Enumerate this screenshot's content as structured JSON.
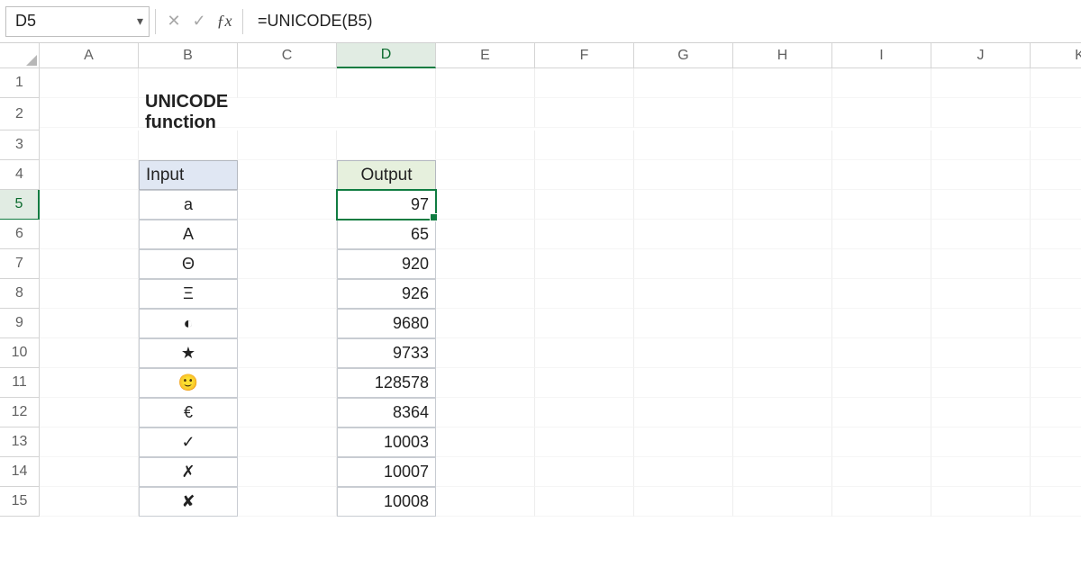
{
  "nameBox": {
    "value": "D5"
  },
  "formulaBar": {
    "value": "=UNICODE(B5)"
  },
  "columns": [
    "A",
    "B",
    "C",
    "D",
    "E",
    "F",
    "G",
    "H",
    "I",
    "J",
    "K"
  ],
  "rowNums": [
    "1",
    "2",
    "3",
    "4",
    "5",
    "6",
    "7",
    "8",
    "9",
    "10",
    "11",
    "12",
    "13",
    "14",
    "15"
  ],
  "selected": {
    "col": "D",
    "row": "5"
  },
  "sheet": {
    "title": "UNICODE function",
    "headers": {
      "input": "Input",
      "output": "Output"
    },
    "rows": [
      {
        "in": "a",
        "out": "97"
      },
      {
        "in": "A",
        "out": "65"
      },
      {
        "in": "Θ",
        "out": "920"
      },
      {
        "in": "Ξ",
        "out": "926"
      },
      {
        "in": "◐",
        "out": "9680"
      },
      {
        "in": "★",
        "out": "9733"
      },
      {
        "in": "🙂",
        "out": "128578"
      },
      {
        "in": "€",
        "out": "8364"
      },
      {
        "in": "✓",
        "out": "10003"
      },
      {
        "in": "✗",
        "out": "10007"
      },
      {
        "in": "✘",
        "out": "10008"
      }
    ]
  }
}
